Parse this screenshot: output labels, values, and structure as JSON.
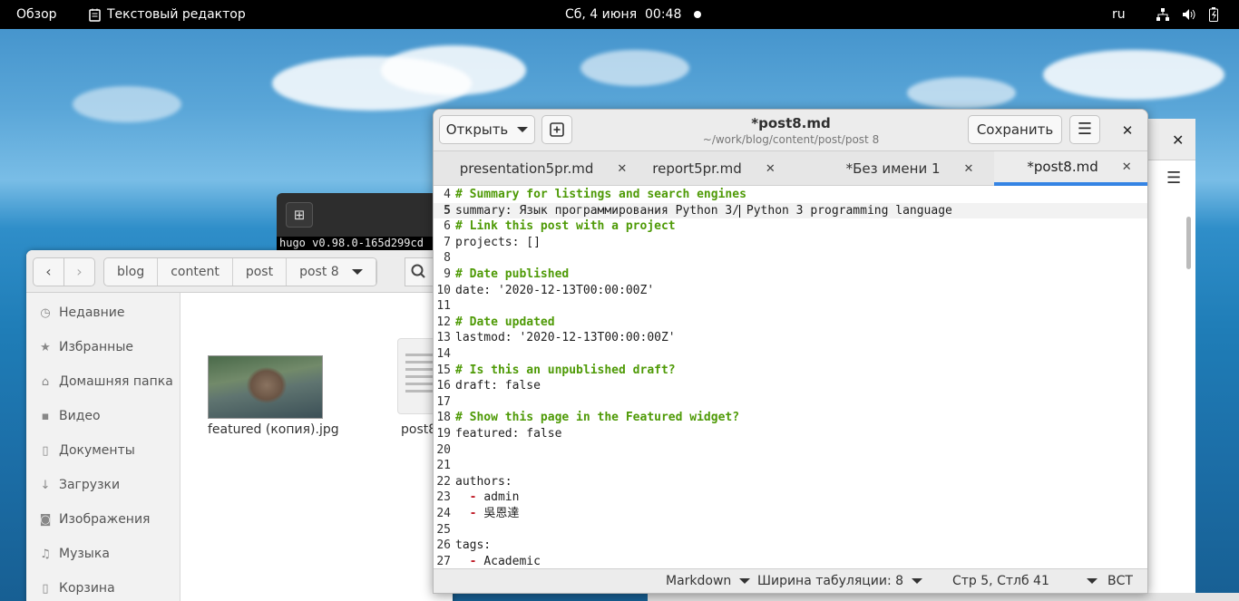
{
  "topbar": {
    "activities": "Обзор",
    "app_menu": "Текстовый редактор",
    "clock": "Сб, 4 июня  00:48",
    "input_lang": "ru"
  },
  "terminal": {
    "output": "hugo v0.98.0-165d299cd"
  },
  "files": {
    "path": [
      "blog",
      "content",
      "post",
      "post 8"
    ],
    "sidebar": [
      {
        "icon": "clock-icon",
        "label": "Недавние"
      },
      {
        "icon": "star-icon",
        "label": "Избранные"
      },
      {
        "icon": "home-icon",
        "label": "Домашняя папка"
      },
      {
        "icon": "video-icon",
        "label": "Видео"
      },
      {
        "icon": "document-icon",
        "label": "Документы"
      },
      {
        "icon": "download-icon",
        "label": "Загрузки"
      },
      {
        "icon": "camera-icon",
        "label": "Изображения"
      },
      {
        "icon": "music-icon",
        "label": "Музыка"
      },
      {
        "icon": "trash-icon",
        "label": "Корзина"
      }
    ],
    "items": [
      {
        "name": "featured (копия).jpg"
      },
      {
        "name": "post8"
      }
    ]
  },
  "gedit": {
    "open_label": "Открыть",
    "title": "*post8.md",
    "subtitle": "~/work/blog/content/post/post 8",
    "save_label": "Сохранить",
    "tabs": [
      {
        "label": "presentation5pr.md",
        "active": false
      },
      {
        "label": "report5pr.md",
        "active": false
      },
      {
        "label": "*Без имени 1",
        "active": false
      },
      {
        "label": "*post8.md",
        "active": true
      }
    ],
    "lines": [
      {
        "n": "4",
        "text": "# Summary for listings and search engines",
        "kind": "comment"
      },
      {
        "n": "5",
        "text": "summary: Язык программирования Python 3/ Python 3 programming language",
        "kind": "code",
        "current": true
      },
      {
        "n": "6",
        "text": "# Link this post with a project",
        "kind": "comment"
      },
      {
        "n": "7",
        "text": "projects: []",
        "kind": "code"
      },
      {
        "n": "8",
        "text": "",
        "kind": "code"
      },
      {
        "n": "9",
        "text": "# Date published",
        "kind": "comment"
      },
      {
        "n": "10",
        "text": "date: '2020-12-13T00:00:00Z'",
        "kind": "code"
      },
      {
        "n": "11",
        "text": "",
        "kind": "code"
      },
      {
        "n": "12",
        "text": "# Date updated",
        "kind": "comment"
      },
      {
        "n": "13",
        "text": "lastmod: '2020-12-13T00:00:00Z'",
        "kind": "code"
      },
      {
        "n": "14",
        "text": "",
        "kind": "code"
      },
      {
        "n": "15",
        "text": "# Is this an unpublished draft?",
        "kind": "comment"
      },
      {
        "n": "16",
        "text": "draft: false",
        "kind": "code"
      },
      {
        "n": "17",
        "text": "",
        "kind": "code"
      },
      {
        "n": "18",
        "text": "# Show this page in the Featured widget?",
        "kind": "comment"
      },
      {
        "n": "19",
        "text": "featured: false",
        "kind": "code"
      },
      {
        "n": "20",
        "text": "",
        "kind": "code"
      },
      {
        "n": "21",
        "text": "",
        "kind": "code"
      },
      {
        "n": "22",
        "text": "authors:",
        "kind": "code"
      },
      {
        "n": "23",
        "text": "admin",
        "kind": "list"
      },
      {
        "n": "24",
        "text": "吳恩達",
        "kind": "list"
      },
      {
        "n": "25",
        "text": "",
        "kind": "code"
      },
      {
        "n": "26",
        "text": "tags:",
        "kind": "code"
      },
      {
        "n": "27",
        "text": "Academic",
        "kind": "list"
      }
    ],
    "status": {
      "language": "Markdown",
      "tab_width": "Ширина табуляции: 8",
      "position": "Стр 5, Стлб 41",
      "mode": "ВСТ"
    }
  }
}
